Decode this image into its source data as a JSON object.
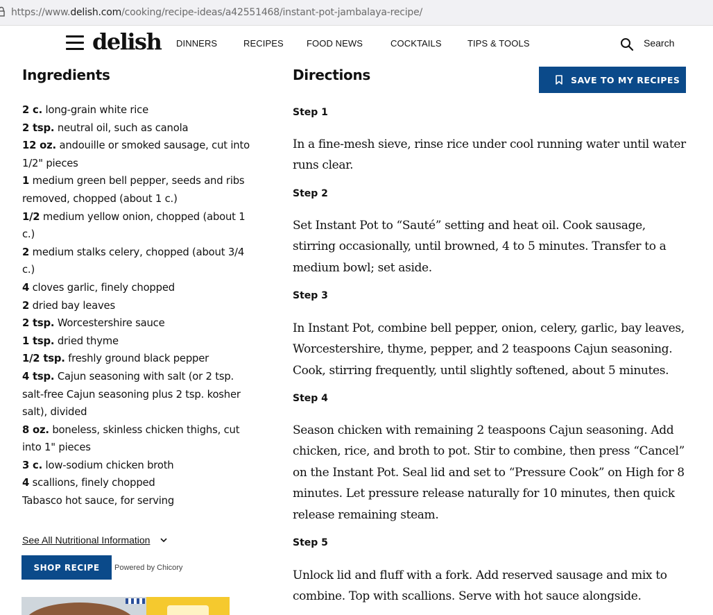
{
  "browser": {
    "url_prefix": "https://www.",
    "url_host": "delish.com",
    "url_path": "/cooking/recipe-ideas/a42551468/instant-pot-jambalaya-recipe/"
  },
  "nav": {
    "logo": "delish",
    "links": [
      "DINNERS",
      "RECIPES",
      "FOOD NEWS",
      "COCKTAILS",
      "TIPS & TOOLS"
    ],
    "search_label": "Search"
  },
  "ingredients": {
    "heading": "Ingredients",
    "items": [
      {
        "qty": "2 c.",
        "text": " long-grain white rice"
      },
      {
        "qty": "2 tsp.",
        "text": " neutral oil, such as canola"
      },
      {
        "qty": "12 oz.",
        "text": " andouille or smoked sausage, cut into 1/2\" pieces"
      },
      {
        "qty": "1",
        "text": " medium green bell pepper, seeds and ribs removed, chopped (about 1 c.)"
      },
      {
        "qty": "1/2",
        "text": " medium yellow onion, chopped (about 1 c.)"
      },
      {
        "qty": "2",
        "text": " medium stalks celery, chopped (about 3/4 c.)"
      },
      {
        "qty": "4",
        "text": " cloves garlic, finely chopped"
      },
      {
        "qty": "2",
        "text": " dried bay leaves"
      },
      {
        "qty": "2 tsp.",
        "text": " Worcestershire sauce"
      },
      {
        "qty": "1 tsp.",
        "text": " dried thyme"
      },
      {
        "qty": "1/2 tsp.",
        "text": " freshly ground black pepper"
      },
      {
        "qty": "4 tsp.",
        "text": " Cajun seasoning with salt (or 2 tsp. salt-free Cajun seasoning plus 2 tsp. kosher salt), divided"
      },
      {
        "qty": "8 oz.",
        "text": " boneless, skinless chicken thighs, cut into 1\" pieces"
      },
      {
        "qty": "3 c.",
        "text": " low-sodium chicken broth"
      },
      {
        "qty": "4",
        "text": " scallions, finely chopped"
      },
      {
        "qty": "",
        "text": "Tabasco hot sauce, for serving"
      }
    ],
    "nutrition_link": "See All Nutritional Information",
    "shop_button": "SHOP RECIPE",
    "powered_by": "Powered by Chicory"
  },
  "directions": {
    "heading": "Directions",
    "save_button": "SAVE TO MY RECIPES",
    "steps": [
      {
        "title": "Step 1",
        "text": "In a fine-mesh sieve, rinse rice under cool running water until water runs clear."
      },
      {
        "title": "Step 2",
        "text": "Set Instant Pot to “Sauté” setting and heat oil. Cook sausage, stirring occasionally, until browned, 4 to 5 minutes. Transfer to a medium bowl; set aside."
      },
      {
        "title": "Step 3",
        "text": "In Instant Pot, combine bell pepper, onion, celery, garlic, bay leaves, Worcestershire, thyme, pepper, and 2 teaspoons Cajun seasoning. Cook, stirring frequently, until slightly softened, about 5 minutes."
      },
      {
        "title": "Step 4",
        "text": "Season chicken with remaining 2 teaspoons Cajun seasoning. Add chicken, rice, and broth to pot. Stir to combine, then press “Cancel” on the Instant Pot. Seal lid and set to “Pressure Cook” on High for 8 minutes. Let pressure release naturally for 10 minutes, then quick release remaining steam."
      },
      {
        "title": "Step 5",
        "text": "Unlock lid and fluff with a fork. Add reserved sausage and mix to combine. Top with scallions. Serve with hot sauce alongside."
      }
    ]
  },
  "colors": {
    "accent": "#0b4a8a"
  },
  "icons": [
    "lock-icon",
    "menu-icon",
    "search-icon",
    "chevron-down-icon",
    "bookmark-icon"
  ]
}
